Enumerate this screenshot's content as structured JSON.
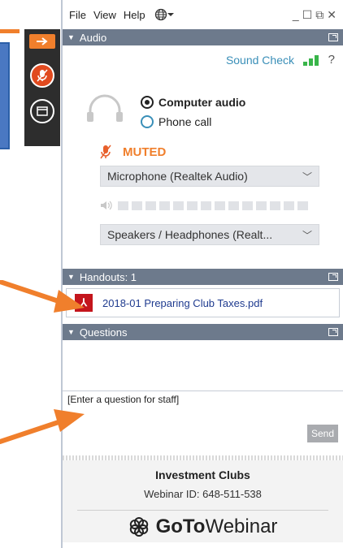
{
  "menu": {
    "file": "File",
    "view": "View",
    "help": "Help"
  },
  "window": {
    "minimize": "_",
    "maximize": "☐",
    "restore": "⧉",
    "close": "✕"
  },
  "audio": {
    "section_title": "Audio",
    "sound_check": "Sound Check",
    "help": "?",
    "options": [
      {
        "label": "Computer audio",
        "selected": true
      },
      {
        "label": "Phone call",
        "selected": false
      }
    ],
    "muted_label": "MUTED",
    "microphone": "Microphone (Realtek Audio)",
    "speakers": "Speakers / Headphones (Realt..."
  },
  "handouts": {
    "section_title": "Handouts: 1",
    "file": "2018-01 Preparing Club Taxes.pdf"
  },
  "questions": {
    "section_title": "Questions",
    "input_placeholder": "[Enter a question for staff]",
    "send_label": "Send"
  },
  "footer": {
    "org": "Investment Clubs",
    "webinar_id": "Webinar ID: 648-511-538",
    "logo_goto": "GoTo",
    "logo_webinar": "Webinar"
  },
  "colors": {
    "accent_orange": "#f07f2c",
    "header_gray": "#6d7a8c",
    "link_blue": "#3a8fb8",
    "signal_green": "#39b54a"
  }
}
